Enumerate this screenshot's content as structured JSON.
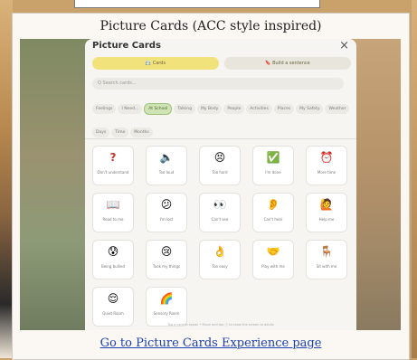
{
  "caption": "Picture Cards (ACC style inspired)",
  "link": "Go to Picture Cards Experience page",
  "modal": {
    "title": "Picture Cards",
    "close": "×",
    "modes": [
      {
        "icon": "📇",
        "label": "Cards"
      },
      {
        "icon": "🔖",
        "label": "Build a sentence"
      }
    ],
    "search_placeholder": "Q  Search cards...",
    "categories": [
      {
        "label": "Feelings",
        "active": false
      },
      {
        "label": "I Need...",
        "active": false
      },
      {
        "label": "At School",
        "active": true
      },
      {
        "label": "Talking",
        "active": false
      },
      {
        "label": "My Body",
        "active": false
      },
      {
        "label": "People",
        "active": false
      },
      {
        "label": "Activities",
        "active": false
      },
      {
        "label": "Places",
        "active": false
      },
      {
        "label": "My Safety",
        "active": false
      },
      {
        "label": "Weather",
        "active": false
      },
      {
        "label": "Days",
        "active": false
      },
      {
        "label": "Time",
        "active": false
      },
      {
        "label": "Months",
        "active": false
      }
    ],
    "cards": [
      {
        "icon": "?",
        "label": "Don't understand",
        "icon_color": "#c0392b"
      },
      {
        "icon": "🔈",
        "label": "Too loud"
      },
      {
        "icon": "😣",
        "label": "Too hard"
      },
      {
        "icon": "✅",
        "label": "I'm done"
      },
      {
        "icon": "⏰",
        "label": "More time"
      },
      {
        "icon": "📖",
        "label": "Read to me"
      },
      {
        "icon": "😕",
        "label": "I'm lost"
      },
      {
        "icon": "👀",
        "label": "Can't see"
      },
      {
        "icon": "👂",
        "label": "Can't hear"
      },
      {
        "icon": "🙋",
        "label": "Help me"
      },
      {
        "icon": "😰",
        "label": "Being bullied"
      },
      {
        "icon": "😢",
        "label": "Took my things"
      },
      {
        "icon": "👌",
        "label": "Too easy"
      },
      {
        "icon": "🤝",
        "label": "Play with me"
      },
      {
        "icon": "🪑",
        "label": "Sit with me"
      },
      {
        "icon": "😌",
        "label": "Quiet Room"
      },
      {
        "icon": "🌈",
        "label": "Sensory Room"
      }
    ],
    "footer_note": "Tap a card to speak • Move and tap ⓘ to show the screen to adults"
  }
}
